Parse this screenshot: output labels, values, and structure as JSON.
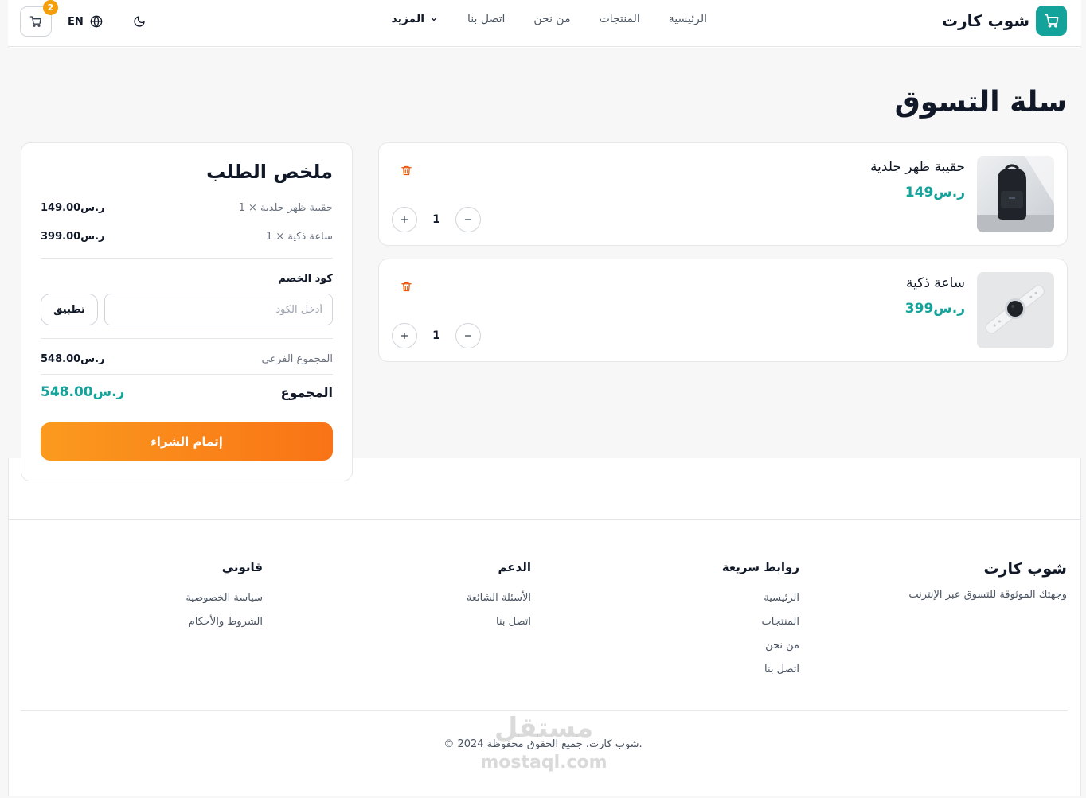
{
  "header": {
    "brand": "شوب كارت",
    "nav": [
      "الرئيسية",
      "المنتجات",
      "من نحن",
      "اتصل بنا"
    ],
    "more_label": "المزيد",
    "lang_label": "EN",
    "cart_count": "2"
  },
  "page": {
    "title": "سلة التسوق"
  },
  "cart": {
    "items": [
      {
        "name": "حقيبة ظهر جلدية",
        "price": "ر.س149",
        "qty": "1"
      },
      {
        "name": "ساعة ذكية",
        "price": "ر.س399",
        "qty": "1"
      }
    ]
  },
  "summary": {
    "title": "ملخص الطلب",
    "lines": [
      {
        "label": "حقيبة ظهر جلدية × 1",
        "value": "ر.س149.00"
      },
      {
        "label": "ساعة ذكية × 1",
        "value": "ر.س399.00"
      }
    ],
    "discount_label": "كود الخصم",
    "discount_placeholder": "أدخل الكود",
    "apply_label": "تطبيق",
    "subtotal_label": "المجموع الفرعي",
    "subtotal_value": "ر.س548.00",
    "total_label": "المجموع",
    "total_value": "ر.س548.00",
    "checkout_label": "إتمام الشراء"
  },
  "footer": {
    "brand": "شوب كارت",
    "tagline": "وجهتك الموثوقة للتسوق عبر الإنترنت",
    "quick_links": {
      "title": "روابط سريعة",
      "links": [
        "الرئيسية",
        "المنتجات",
        "من نحن",
        "اتصل بنا"
      ]
    },
    "support": {
      "title": "الدعم",
      "links": [
        "الأسئلة الشائعة",
        "اتصل بنا"
      ]
    },
    "legal": {
      "title": "قانوني",
      "links": [
        "سياسة الخصوصية",
        "الشروط والأحكام"
      ]
    },
    "copyright": "© 2024 شوب كارت. جميع الحقوق محفوظة."
  },
  "watermark": {
    "arabic": "مستقل",
    "latin": "mostaql.com"
  },
  "colors": {
    "brand": "#14a39a",
    "accent": "#f97316",
    "badge": "#f59e0b",
    "trash": "#ea580c"
  },
  "icons": [
    "cart-icon",
    "globe-icon",
    "moon-icon",
    "chevron-down-icon",
    "trash-icon",
    "plus-icon",
    "minus-icon"
  ]
}
